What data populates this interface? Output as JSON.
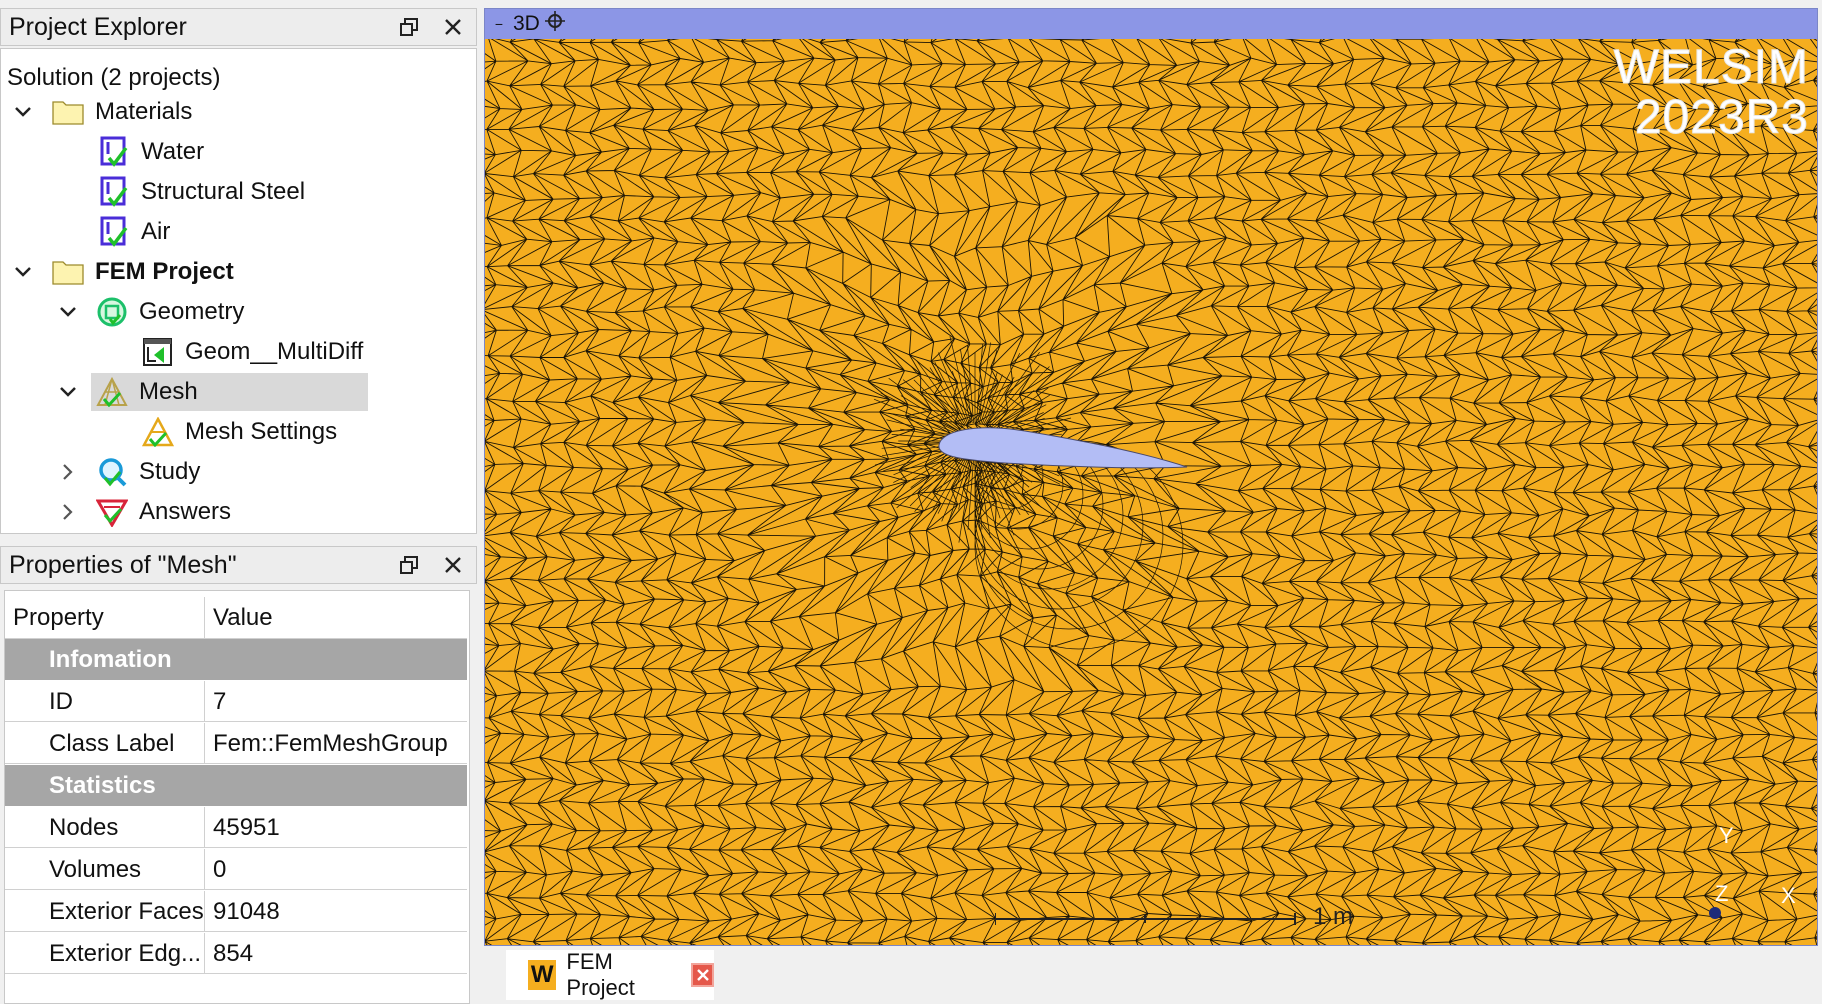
{
  "explorer": {
    "title": "Project Explorer",
    "tree": {
      "solution": "Solution (2 projects)",
      "materials": "Materials",
      "water": "Water",
      "steel": "Structural Steel",
      "air": "Air",
      "fem_project": "FEM Project",
      "geometry": "Geometry",
      "geom_item": "Geom__MultiDiff",
      "mesh": "Mesh",
      "mesh_settings": "Mesh Settings",
      "study": "Study",
      "answers": "Answers"
    }
  },
  "properties": {
    "title": "Properties of \"Mesh\"",
    "header": {
      "property": "Property",
      "value": "Value"
    },
    "groups": {
      "info": "Infomation",
      "stats": "Statistics"
    },
    "rows": {
      "id": {
        "label": "ID",
        "value": "7"
      },
      "class_label": {
        "label": "Class Label",
        "value": "Fem::FemMeshGroup"
      },
      "nodes": {
        "label": "Nodes",
        "value": "45951"
      },
      "volumes": {
        "label": "Volumes",
        "value": "0"
      },
      "ext_faces": {
        "label": "Exterior Faces",
        "value": "91048"
      },
      "ext_edges": {
        "label": "Exterior Edg...",
        "value": "854"
      }
    }
  },
  "viewport": {
    "view_mode": "3D",
    "watermark_line1": "WELSIM",
    "watermark_line2": "2023R3",
    "scale_label": "1 m",
    "axis_y": "Y",
    "axis_z": "Z",
    "axis_x": "X",
    "mesh_color": "#f5ae1f",
    "airfoil_color": "#b3bdf5"
  },
  "tabs": {
    "doc_tab": "FEM Project"
  }
}
